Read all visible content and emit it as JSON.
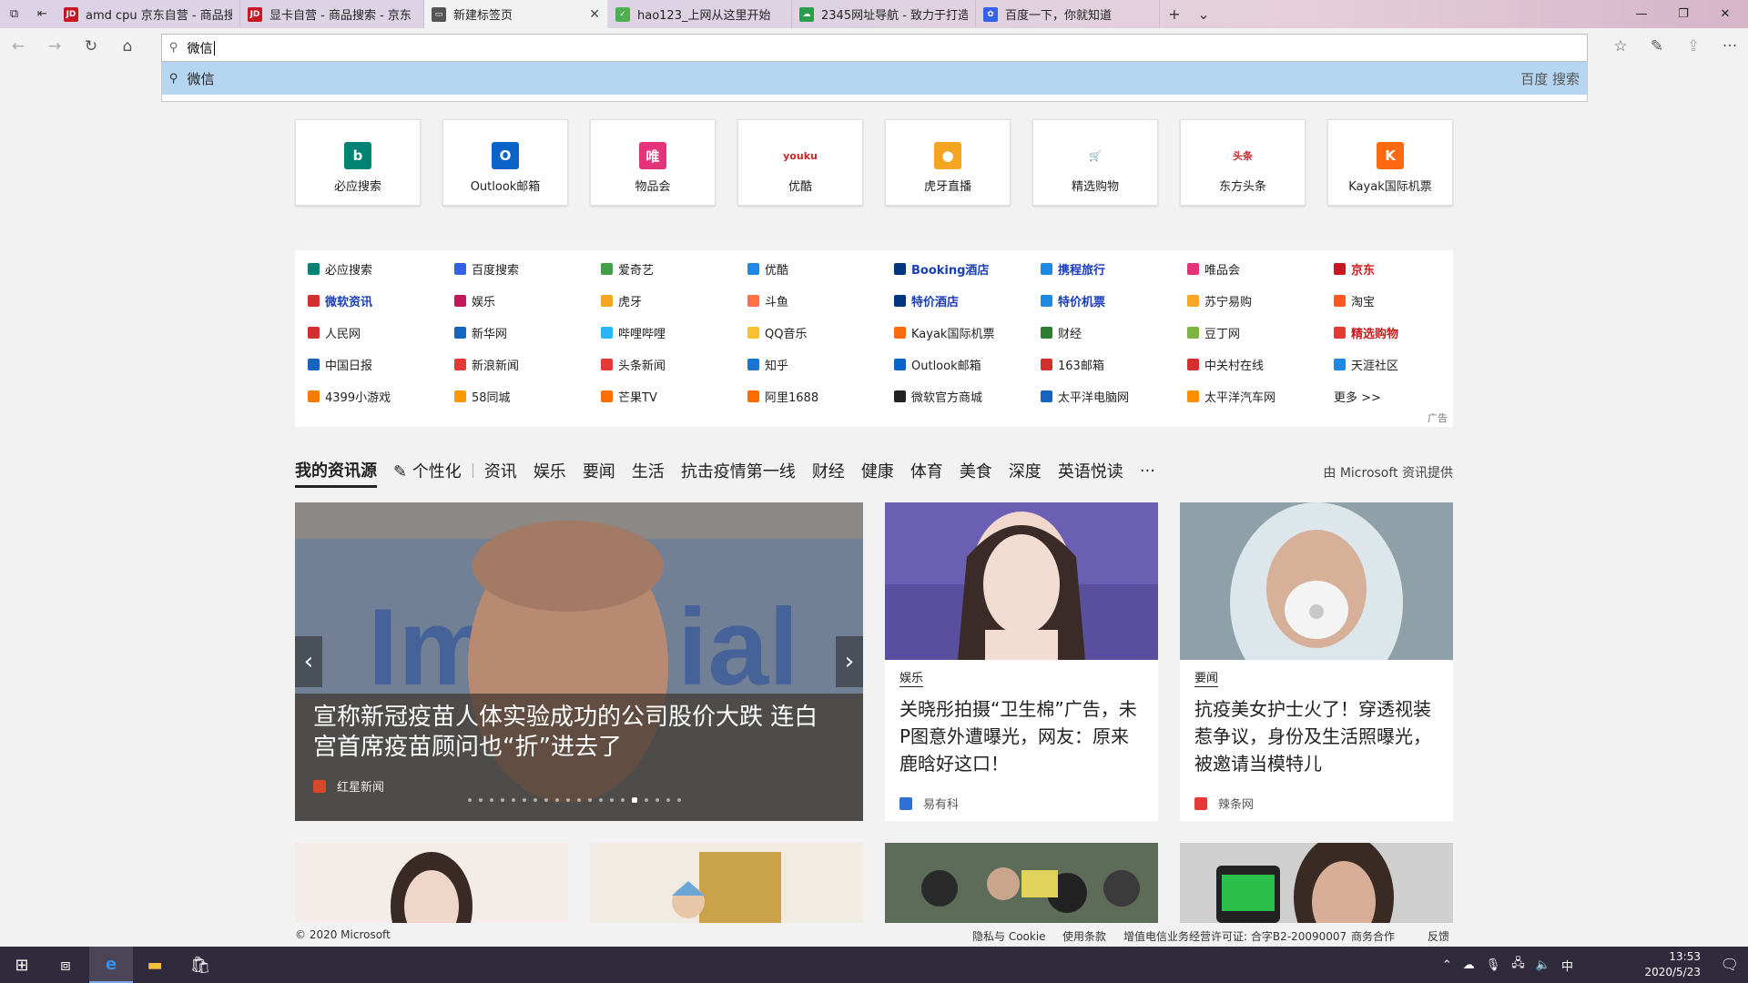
{
  "tabs": [
    {
      "title": "amd cpu 京东自营 - 商品搜",
      "favicon": "JD",
      "fav_color": "#c81623"
    },
    {
      "title": "显卡自营 - 商品搜索 - 京东",
      "favicon": "JD",
      "fav_color": "#c81623"
    },
    {
      "title": "新建标签页",
      "favicon": "▭",
      "fav_color": "#555555",
      "active": true
    },
    {
      "title": "hao123_上网从这里开始",
      "favicon": "✓",
      "fav_color": "#4caf50"
    },
    {
      "title": "2345网址导航 - 致力于打造",
      "favicon": "☁",
      "fav_color": "#2e9b4d"
    },
    {
      "title": "百度一下，你就知道",
      "favicon": "✿",
      "fav_color": "#3561e6"
    }
  ],
  "address": {
    "value": "微信"
  },
  "suggestion": {
    "text": "微信",
    "engine": "百度 搜索"
  },
  "tiles": [
    {
      "label": "必应搜索",
      "glyph": "b",
      "color": "#008373"
    },
    {
      "label": "Outlook邮箱",
      "glyph": "O",
      "color": "#0a64c8"
    },
    {
      "label": "物品会",
      "glyph": "唯",
      "color": "#e4337a"
    },
    {
      "label": "优酷",
      "glyph": "youku",
      "color": "#ffffff"
    },
    {
      "label": "虎牙直播",
      "glyph": "●",
      "color": "#f4a623"
    },
    {
      "label": "精选购物",
      "glyph": "🛒",
      "color": "#ffffff"
    },
    {
      "label": "东方头条",
      "glyph": "头条",
      "color": "#ffffff"
    },
    {
      "label": "Kayak国际机票",
      "glyph": "K",
      "color": "#ff690f"
    }
  ],
  "links": [
    [
      {
        "label": "必应搜索",
        "color": "#008373"
      },
      {
        "label": "微软资讯",
        "color": "#d32f2f",
        "style": "bold blue"
      },
      {
        "label": "人民网",
        "color": "#d32f2f"
      },
      {
        "label": "中国日报",
        "color": "#1565c0"
      },
      {
        "label": "4399小游戏",
        "color": "#f57c00"
      }
    ],
    [
      {
        "label": "百度搜索",
        "color": "#3561e6"
      },
      {
        "label": "娱乐",
        "color": "#c2185b"
      },
      {
        "label": "新华网",
        "color": "#1565c0"
      },
      {
        "label": "新浪新闻",
        "color": "#e53935"
      },
      {
        "label": "58同城",
        "color": "#ff9800"
      }
    ],
    [
      {
        "label": "爱奇艺",
        "color": "#43a047"
      },
      {
        "label": "虎牙",
        "color": "#f4a623"
      },
      {
        "label": "哔哩哔哩",
        "color": "#29b6f6"
      },
      {
        "label": "头条新闻",
        "color": "#e53935"
      },
      {
        "label": "芒果TV",
        "color": "#ff6f00"
      }
    ],
    [
      {
        "label": "优酷",
        "color": "#1e88e5"
      },
      {
        "label": "斗鱼",
        "color": "#ff7043"
      },
      {
        "label": "QQ音乐",
        "color": "#fbc02d"
      },
      {
        "label": "知乎",
        "color": "#1976d2"
      },
      {
        "label": "阿里1688",
        "color": "#ff6d00"
      }
    ],
    [
      {
        "label": "Booking酒店",
        "color": "#003580",
        "style": "bold blue"
      },
      {
        "label": "特价酒店",
        "color": "#003580",
        "style": "bold blue"
      },
      {
        "label": "Kayak国际机票",
        "color": "#ff690f"
      },
      {
        "label": "Outlook邮箱",
        "color": "#0a64c8"
      },
      {
        "label": "微软官方商城",
        "color": "#222222"
      }
    ],
    [
      {
        "label": "携程旅行",
        "color": "#1e88e5",
        "style": "bold blue"
      },
      {
        "label": "特价机票",
        "color": "#1e88e5",
        "style": "bold blue"
      },
      {
        "label": "财经",
        "color": "#2e7d32"
      },
      {
        "label": "163邮箱",
        "color": "#d32f2f"
      },
      {
        "label": "太平洋电脑网",
        "color": "#1565c0"
      }
    ],
    [
      {
        "label": "唯品会",
        "color": "#e4337a"
      },
      {
        "label": "苏宁易购",
        "color": "#f9a825"
      },
      {
        "label": "豆丁网",
        "color": "#7cb342"
      },
      {
        "label": "中关村在线",
        "color": "#d32f2f"
      },
      {
        "label": "太平洋汽车网",
        "color": "#ff8f00"
      }
    ],
    [
      {
        "label": "京东",
        "color": "#c81623",
        "style": "bold red"
      },
      {
        "label": "淘宝",
        "color": "#ff5722"
      },
      {
        "label": "精选购物",
        "color": "#e53935",
        "style": "bold red"
      },
      {
        "label": "天涯社区",
        "color": "#1e88e5"
      },
      {
        "label": "更多 >>",
        "color": "",
        "style": ""
      }
    ]
  ],
  "ad_label": "广告",
  "news_nav": {
    "mine": "我的资讯源",
    "personalize": "个性化",
    "categories": [
      "资讯",
      "娱乐",
      "要闻",
      "生活",
      "抗击疫情第一线",
      "财经",
      "健康",
      "体育",
      "美食",
      "深度",
      "英语悦读"
    ],
    "more": "···",
    "provider": "由 Microsoft 资讯提供"
  },
  "hero": {
    "headline": "宣称新冠疫苗人体实验成功的公司股价大跌 连白宫首席疫苗顾问也“折”进去了",
    "source": "红星新闻",
    "dot_count": 20,
    "active_dot": 15
  },
  "cards": [
    {
      "category": "娱乐",
      "title": "关晓彤拍摄“卫生棉”广告，未P图意外遭曝光，网友：原来鹿晗好这口！",
      "source": "易有科",
      "src_color": "#2f6fd6"
    },
    {
      "category": "要闻",
      "title": "抗疫美女护士火了！穿透视装惹争议，身份及生活照曝光，被邀请当模特儿",
      "source": "辣条网",
      "src_color": "#e53935"
    }
  ],
  "footer": {
    "copyright": "© 2020 Microsoft",
    "links": [
      "隐私与 Cookie",
      "使用条款",
      "增值电信业务经营许可证: 合字B2-20090007",
      "商务合作",
      "反馈"
    ]
  },
  "taskbar": {
    "time": "13:53",
    "date": "2020/5/23",
    "ime": "中"
  }
}
